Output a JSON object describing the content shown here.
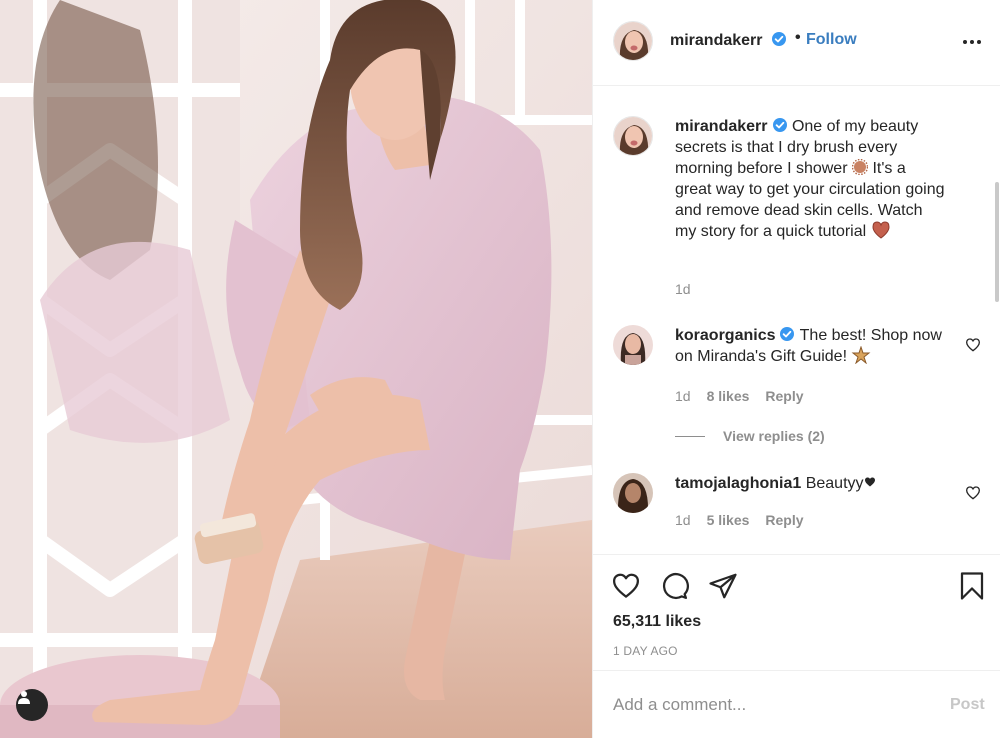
{
  "header": {
    "username": "mirandakerr",
    "separator": "•",
    "follow_label": "Follow"
  },
  "caption": {
    "username": "mirandakerr",
    "text_1": "One of my beauty secrets is that I dry brush every morning before I shower",
    "text_2": "It's a great way to get your circulation going and remove dead skin cells. Watch my story for a quick tutorial",
    "age": "1d"
  },
  "comments": [
    {
      "username": "koraorganics",
      "text": "The best! Shop now on Miranda's Gift Guide!",
      "age": "1d",
      "likes": "8 likes",
      "reply_label": "Reply",
      "view_replies": "View replies (2)"
    },
    {
      "username": "tamojalaghonia1",
      "text": "Beautyy",
      "age": "1d",
      "likes": "5 likes",
      "reply_label": "Reply"
    }
  ],
  "stats": {
    "likes": "65,311 likes",
    "posted": "1 DAY AGO"
  },
  "composer": {
    "placeholder": "Add a comment...",
    "post_label": "Post"
  },
  "icons": [
    "tag-user-icon",
    "verified-icon",
    "more-options-icon",
    "like-icon",
    "comment-icon",
    "share-icon",
    "save-icon",
    "heart-small-icon",
    "emoji-icon"
  ],
  "colors": {
    "link": "#3a7dbf",
    "verified": "#3897f0",
    "muted": "#8e8e8e",
    "border": "#efefef"
  }
}
